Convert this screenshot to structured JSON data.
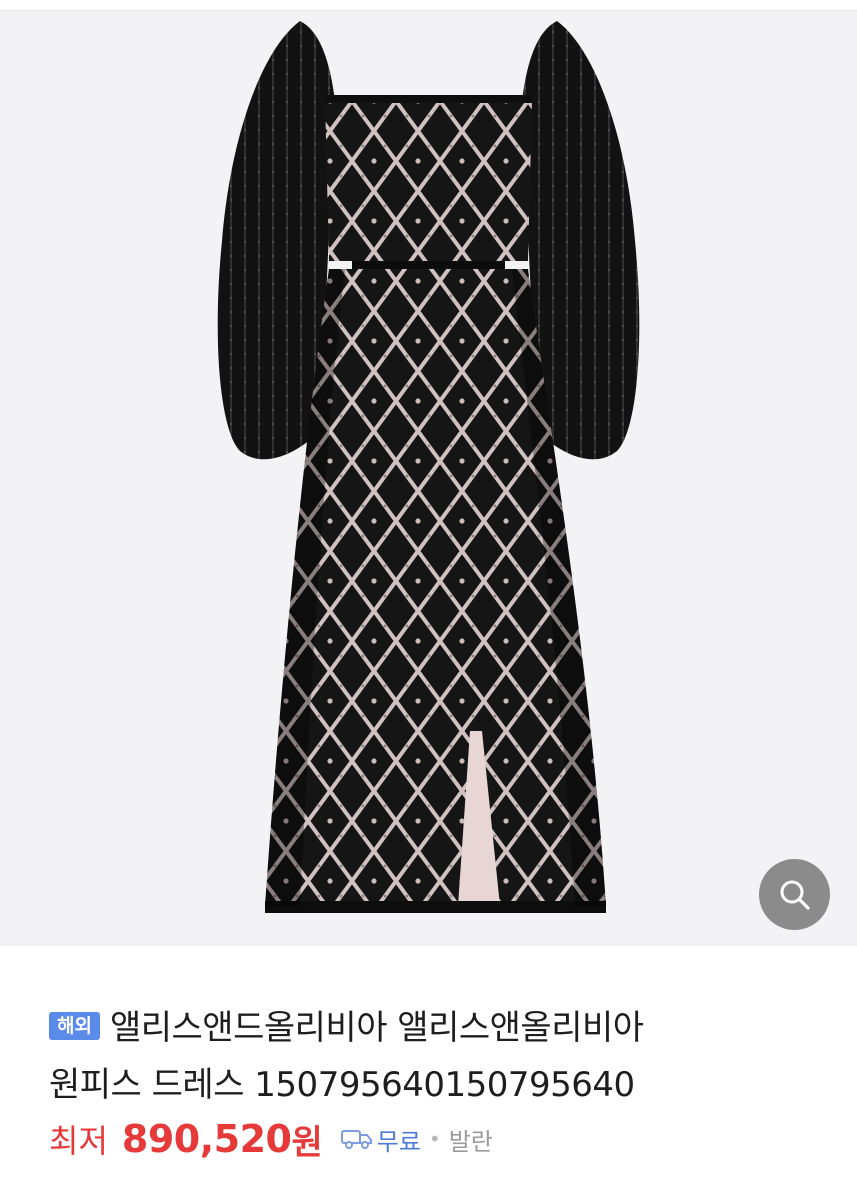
{
  "image": {
    "alt": "",
    "background": "#f3f3f5",
    "icon": "dress-image"
  },
  "zoom_button": {
    "icon": "search-icon"
  },
  "product": {
    "badge": "해외",
    "title_line1": "앨리스앤드올리비아 앨리스앤올리비아",
    "title_line2": "원피스 드레스 150795640150795640"
  },
  "price": {
    "label": "최저",
    "value": "890,520",
    "unit": "원"
  },
  "shipping": {
    "icon": "truck-icon",
    "fee": "무료",
    "separator": "•",
    "day": "발란"
  },
  "colors": {
    "accent_red": "#e63a3a",
    "accent_blue": "#4f79d6",
    "badge_blue": "#5a8be8"
  }
}
